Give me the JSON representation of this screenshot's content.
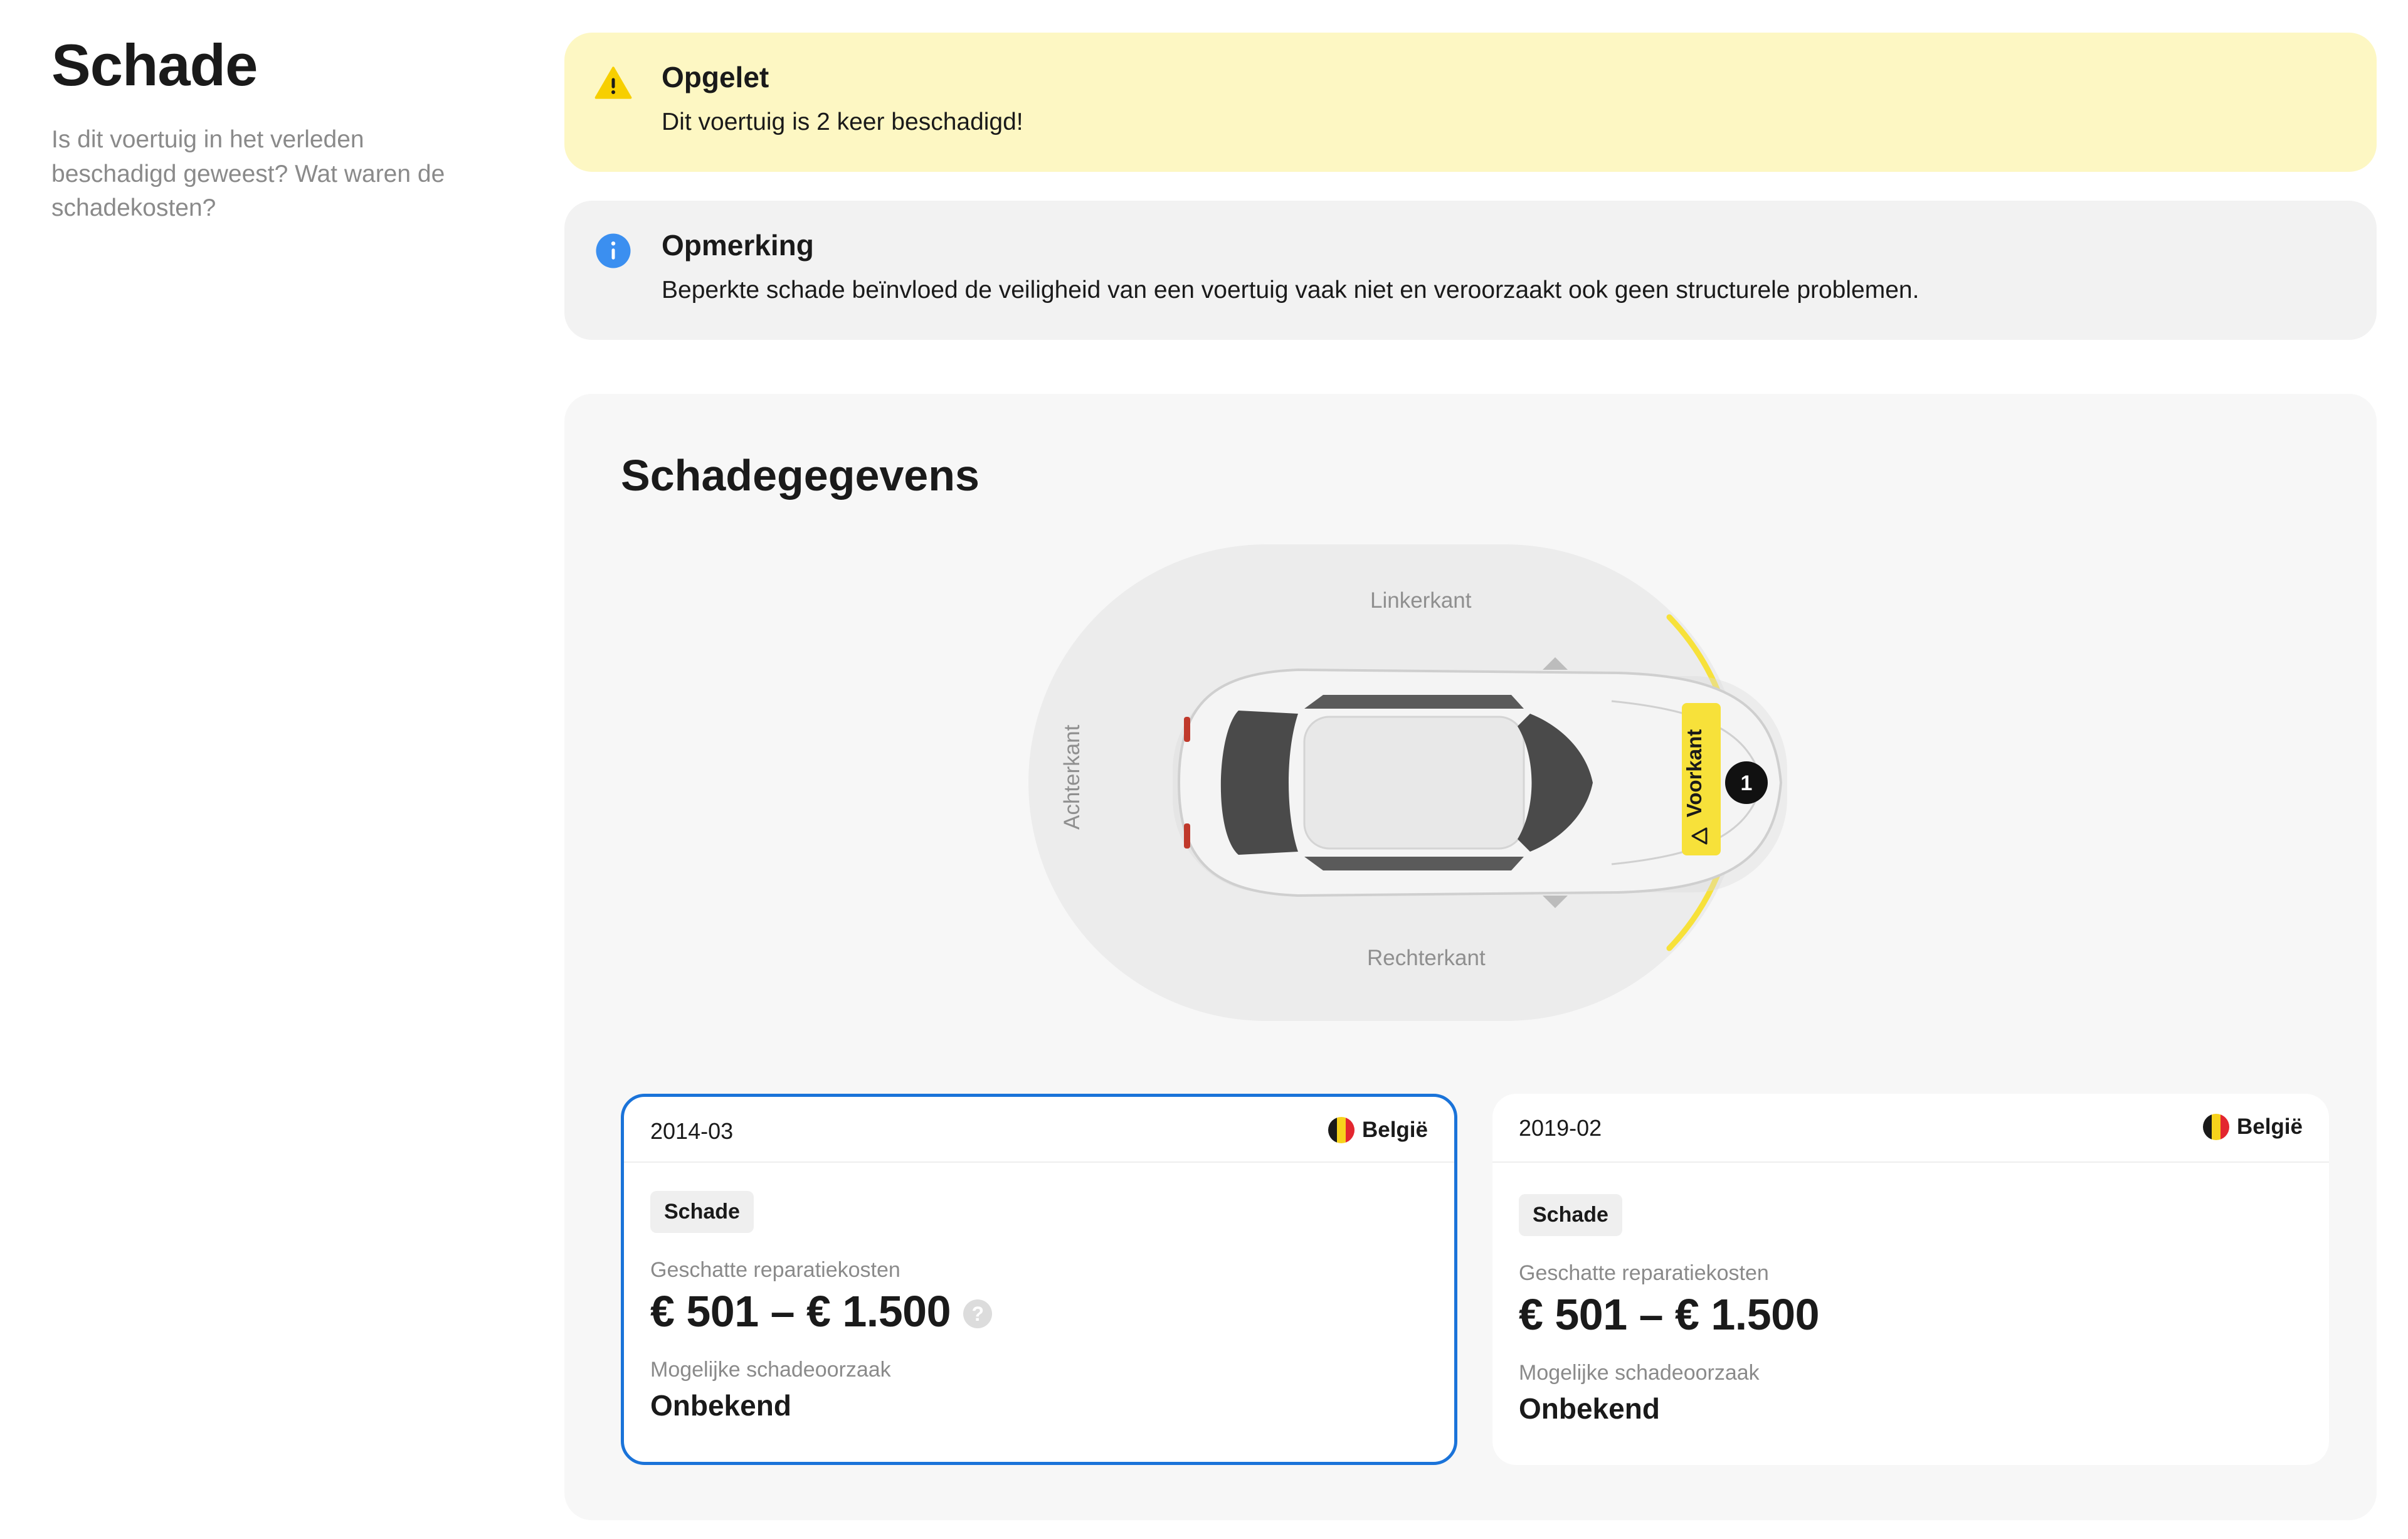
{
  "sidebar": {
    "title": "Schade",
    "subtitle": "Is dit voertuig in het verleden beschadigd geweest? Wat waren de schadekosten?"
  },
  "alerts": [
    {
      "type": "warning",
      "icon": "warning-triangle-icon",
      "color": "#f7cf00",
      "title": "Opgelet",
      "text": "Dit voertuig is 2 keer beschadigd!"
    },
    {
      "type": "info",
      "icon": "info-circle-icon",
      "color": "#3b8ff0",
      "title": "Opmerking",
      "text": "Beperkte schade beïnvloed de veiligheid van een voertuig vaak niet en veroorzaakt ook geen structurele problemen."
    }
  ],
  "details": {
    "title": "Schadegegevens",
    "diagram": {
      "left_label": "Linkerkant",
      "right_label": "Rechterkant",
      "rear_label": "Achterkant",
      "front_label": "Voorkant",
      "front_damage_count": "1",
      "highlight_color": "#f7e13a"
    },
    "cards": [
      {
        "date": "2014-03",
        "country": "België",
        "tag": "Schade",
        "cost_label": "Geschatte reparatiekosten",
        "cost": "€ 501 – € 1.500",
        "help": "?",
        "cause_label": "Mogelijke schadeoorzaak",
        "cause": "Onbekend",
        "selected": true
      },
      {
        "date": "2019-02",
        "country": "België",
        "tag": "Schade",
        "cost_label": "Geschatte reparatiekosten",
        "cost": "€ 501 – € 1.500",
        "cause_label": "Mogelijke schadeoorzaak",
        "cause": "Onbekend",
        "selected": false
      }
    ]
  },
  "colors": {
    "accent_selected": "#1a73d9",
    "warning_bg": "#fdf7c3",
    "info_bg": "#f2f2f2"
  }
}
